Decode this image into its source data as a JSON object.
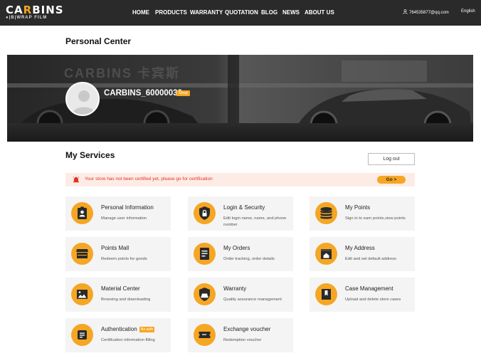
{
  "brand": {
    "name_pre": "CA",
    "name_hl": "R",
    "name_post": "BINS",
    "tagline": "●|B|WRAP FILM"
  },
  "nav": [
    "HOME",
    "PRODUCTS",
    "WARRANTY",
    "QUOTATION",
    "BLOG",
    "NEWS",
    "ABOUT US"
  ],
  "user": {
    "email": "764535877@qq.com",
    "language": "English"
  },
  "page_title": "Personal Center",
  "profile": {
    "banner_brand": "CARBINS 卡宾斯",
    "username": "CARBINS_60000032",
    "badge": "Shop"
  },
  "services": {
    "title": "My Services",
    "logout": "Log out",
    "alert_text": "Your store has not been certified yet, please go for certification",
    "go_label": "Go >",
    "cards": [
      {
        "title": "Personal Information",
        "desc": "Manage user information",
        "icon": "id-card-icon"
      },
      {
        "title": "Login & Security",
        "desc": "Edit login name, name, and phone number",
        "icon": "lock-shield-icon"
      },
      {
        "title": "My Points",
        "desc": "Sign in to earn points,view points",
        "icon": "coin-stack-icon"
      },
      {
        "title": "Points Mall",
        "desc": "Redeem points for goods",
        "icon": "shop-icon"
      },
      {
        "title": "My Orders",
        "desc": "Order tracking, order details",
        "icon": "order-list-icon"
      },
      {
        "title": "My Address",
        "desc": "Edit and set default address",
        "icon": "home-address-icon"
      },
      {
        "title": "Material Center",
        "desc": "Browsing and downloading",
        "icon": "image-icon"
      },
      {
        "title": "Warranty",
        "desc": "Quality assurance management",
        "icon": "car-shield-icon"
      },
      {
        "title": "Case Management",
        "desc": "Upload and delete store cases",
        "icon": "bookmark-icon"
      },
      {
        "title": "Authentication",
        "desc": "Certification information filling",
        "icon": "certificate-icon",
        "badge": "No auth"
      },
      {
        "title": "Exchange voucher",
        "desc": "Redemption voucher",
        "icon": "ticket-icon"
      }
    ]
  },
  "colors": {
    "accent": "#f5a623",
    "topbar": "#2a2a2a",
    "alert_bg": "#fdece6",
    "alert_text": "#e53020"
  }
}
